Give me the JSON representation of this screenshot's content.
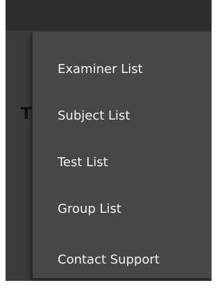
{
  "background": {
    "title_fragment": "T"
  },
  "menu": {
    "items": [
      {
        "label": "Examiner List"
      },
      {
        "label": "Subject List"
      },
      {
        "label": "Test List"
      },
      {
        "label": "Group List"
      },
      {
        "label": "Contact Support"
      }
    ]
  },
  "colors": {
    "app_bar": "#2d2d2d",
    "scrim": "#3b3b3b",
    "menu_surface": "#474747",
    "menu_text": "#f2f2f2"
  }
}
